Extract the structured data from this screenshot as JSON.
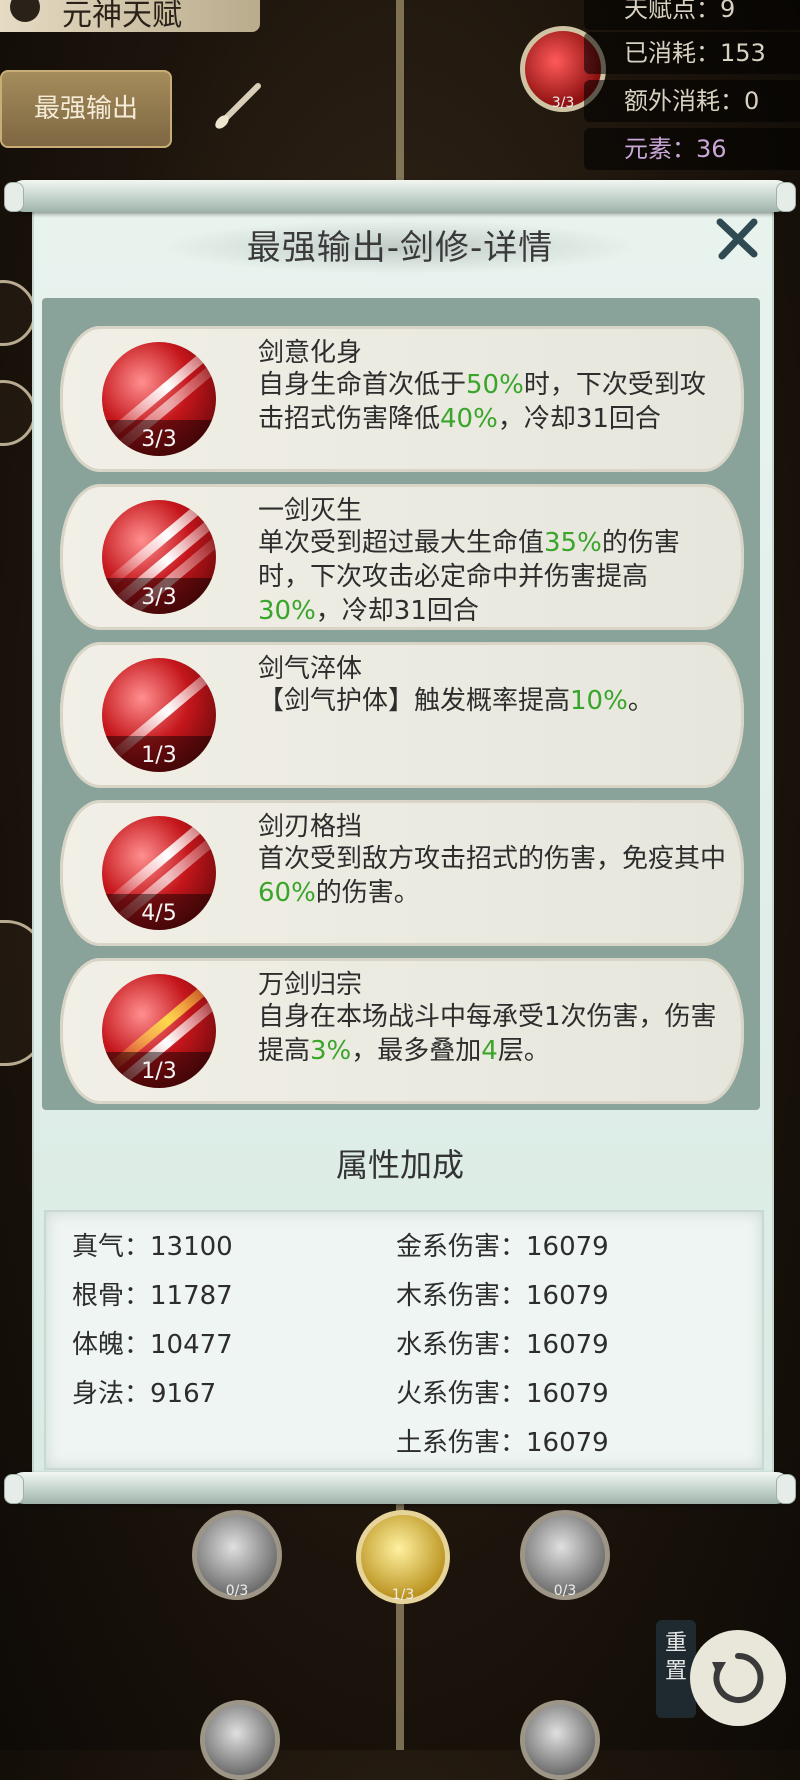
{
  "background": {
    "page_title": "元神天赋",
    "best_output_button": "最强输出",
    "stats": [
      {
        "label": "天赋点：9"
      },
      {
        "label": "已消耗：153"
      },
      {
        "label": "额外消耗：0"
      },
      {
        "label": "元素：36"
      }
    ],
    "top_node_count": "3/3",
    "bottom_nodes": [
      {
        "count": "0/3"
      },
      {
        "count": "1/3"
      },
      {
        "count": "0/3"
      }
    ],
    "reset_label": "重置"
  },
  "dialog": {
    "title": "最强输出-剑修-详情",
    "talents": [
      {
        "name": "剑意化身",
        "level": "3/3",
        "desc": [
          {
            "t": "自身生命首次低于"
          },
          {
            "t": "50%",
            "hl": true
          },
          {
            "t": "时，下次受到攻击招式伤害降低"
          },
          {
            "t": "40%",
            "hl": true
          },
          {
            "t": "，冷却31回合"
          }
        ]
      },
      {
        "name": "一剑灭生",
        "level": "3/3",
        "desc": [
          {
            "t": "单次受到超过最大生命值"
          },
          {
            "t": "35%",
            "hl": true
          },
          {
            "t": "的伤害时，下次攻击必定命中并伤害提高"
          },
          {
            "t": "30%",
            "hl": true
          },
          {
            "t": "，冷却31回合"
          }
        ]
      },
      {
        "name": "剑气淬体",
        "level": "1/3",
        "desc": [
          {
            "t": "【剑气护体】触发概率提高"
          },
          {
            "t": "10%",
            "hl": true
          },
          {
            "t": "。"
          }
        ]
      },
      {
        "name": "剑刃格挡",
        "level": "4/5",
        "desc": [
          {
            "t": "首次受到敌方攻击招式的伤害，免疫其中"
          },
          {
            "t": "60%",
            "hl": true
          },
          {
            "t": "的伤害。"
          }
        ]
      },
      {
        "name": "万剑归宗",
        "level": "1/3",
        "desc": [
          {
            "t": "自身在本场战斗中每承受1次伤害，伤害提高"
          },
          {
            "t": "3%",
            "hl": true
          },
          {
            "t": "，最多叠加"
          },
          {
            "t": "4",
            "hl": true
          },
          {
            "t": "层。"
          }
        ]
      }
    ],
    "attributes_title": "属性加成",
    "attributes_left": [
      {
        "label": "真气：",
        "value": "13100"
      },
      {
        "label": "根骨：",
        "value": "11787"
      },
      {
        "label": "体魄：",
        "value": "10477"
      },
      {
        "label": "身法：",
        "value": "9167"
      }
    ],
    "attributes_right": [
      {
        "label": "金系伤害：",
        "value": "16079"
      },
      {
        "label": "木系伤害：",
        "value": "16079"
      },
      {
        "label": "水系伤害：",
        "value": "16079"
      },
      {
        "label": "火系伤害：",
        "value": "16079"
      },
      {
        "label": "土系伤害：",
        "value": "16079"
      }
    ]
  },
  "colors": {
    "highlight": "#3aa52b",
    "panel": "#e4f0eb",
    "list_bg": "#8aa39a"
  }
}
